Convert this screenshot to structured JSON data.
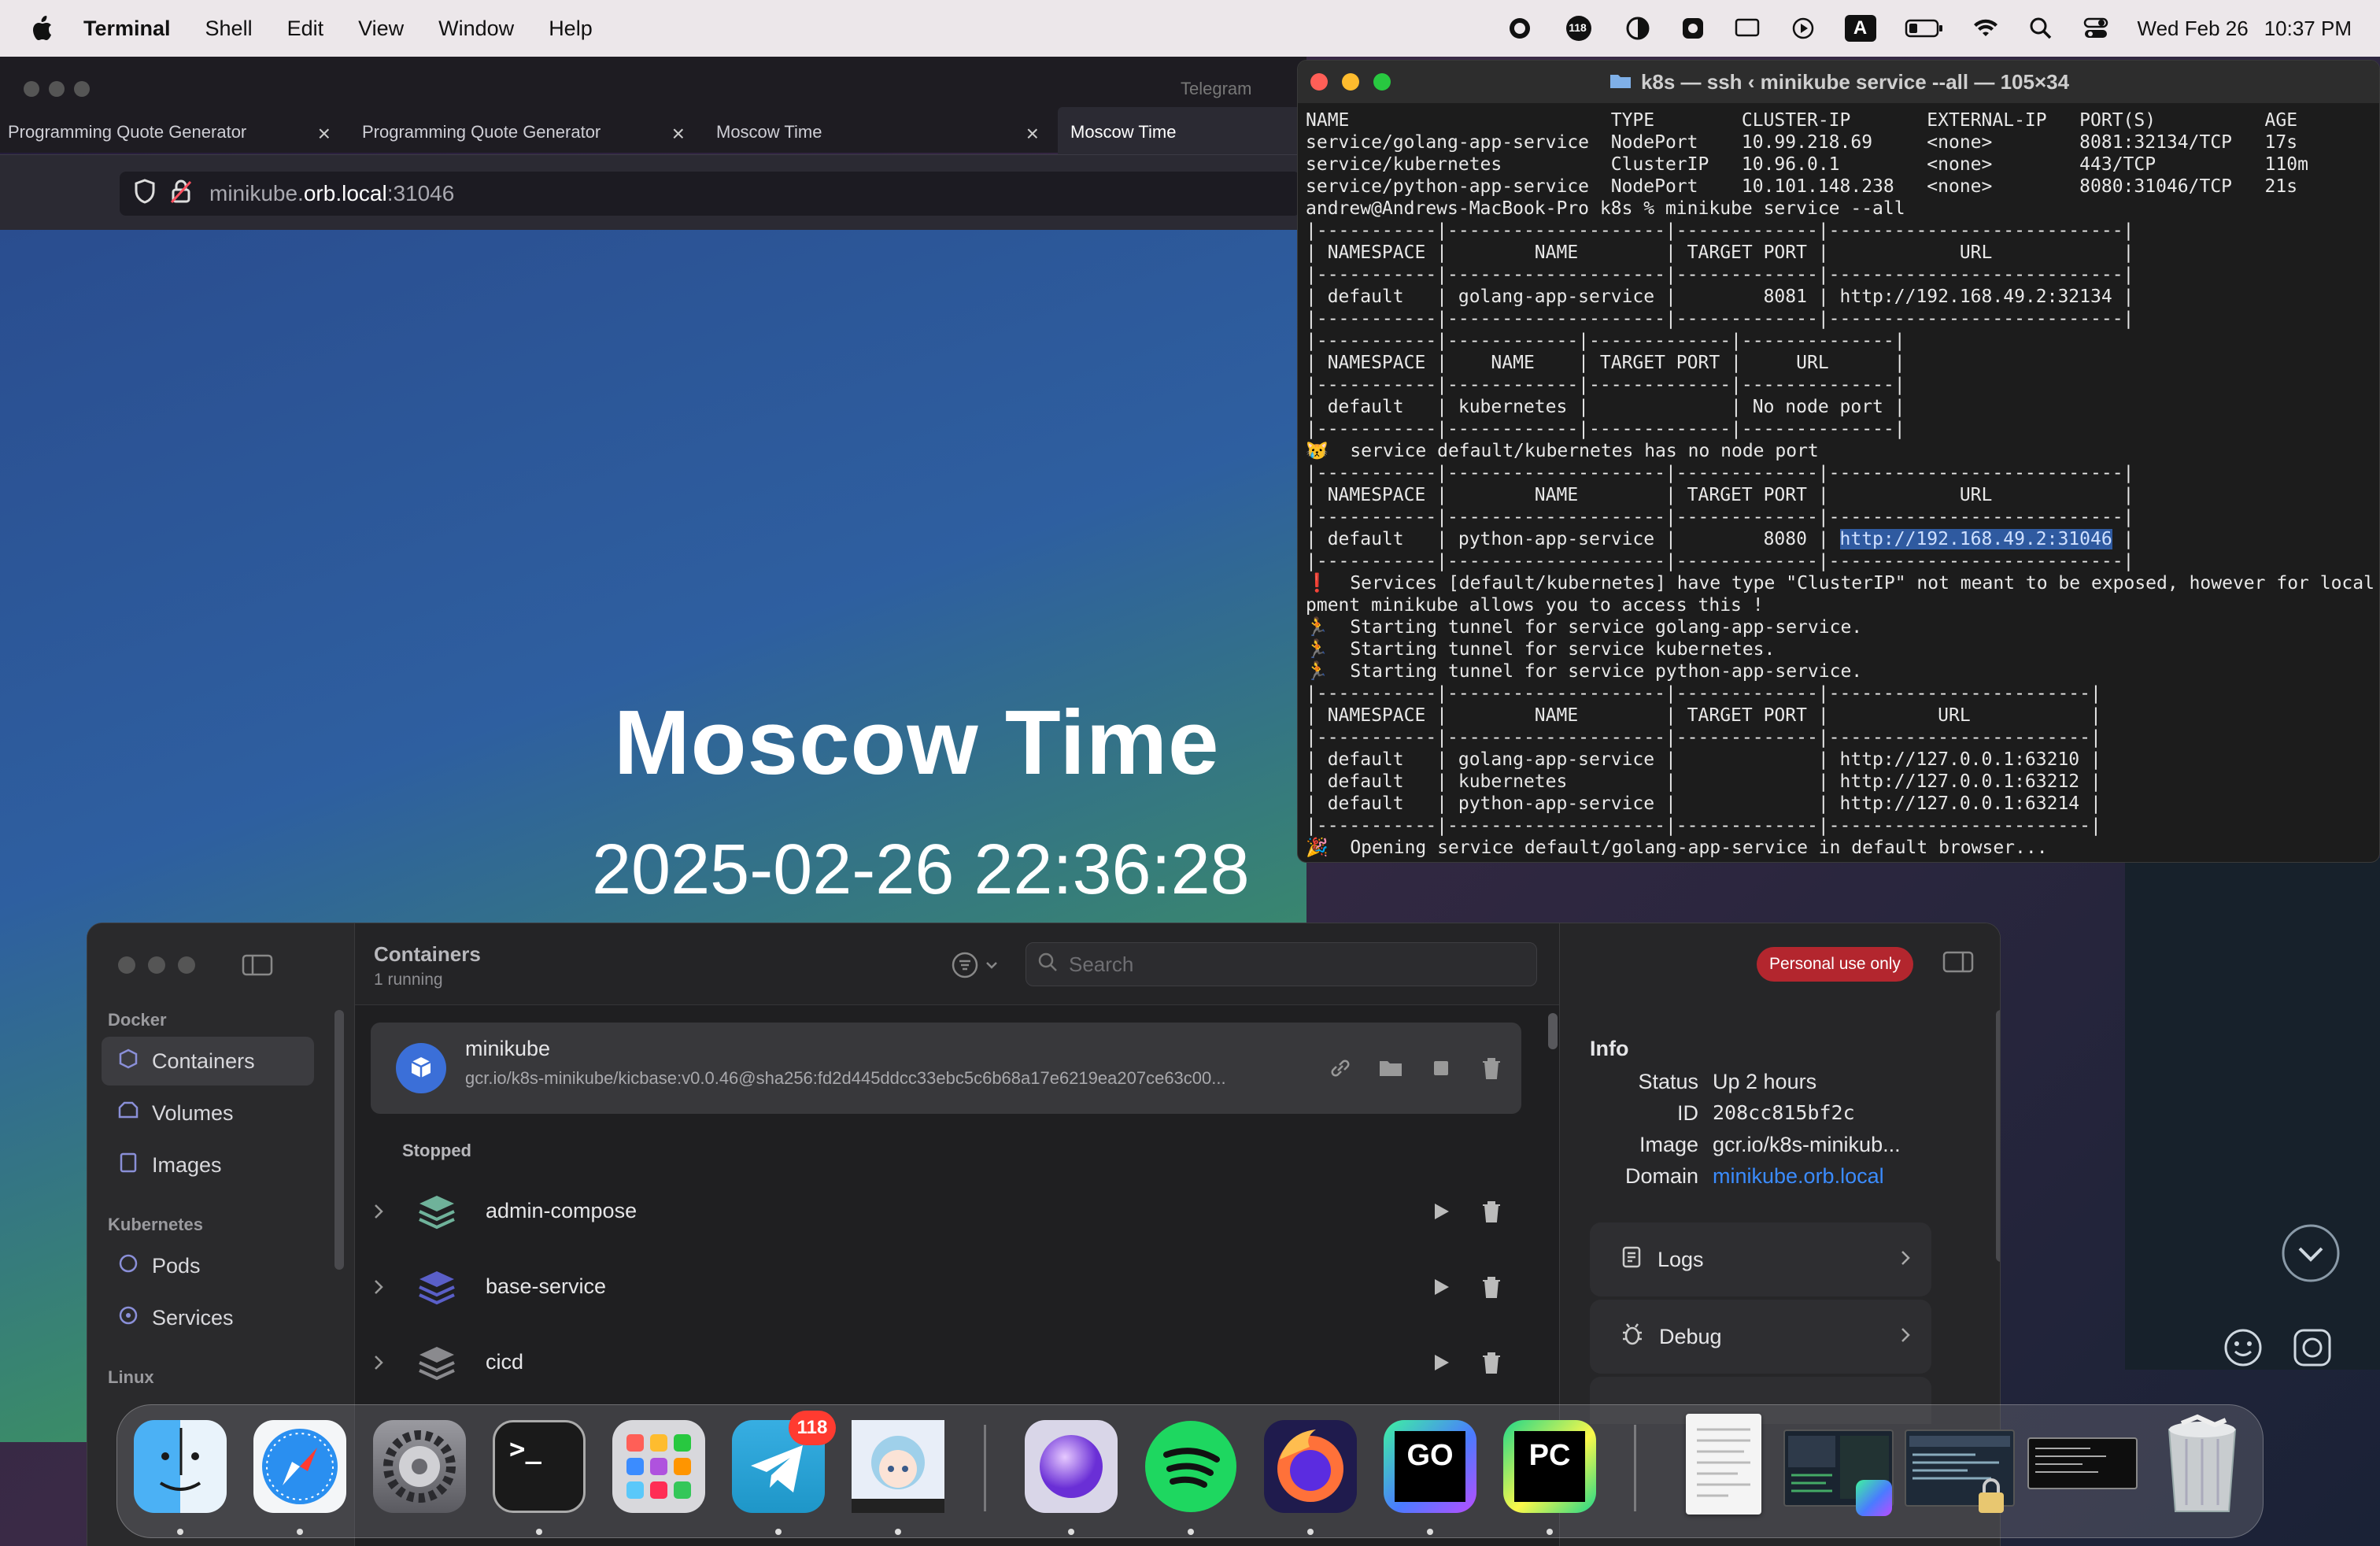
{
  "menubar": {
    "app": "Terminal",
    "menus": [
      "Shell",
      "Edit",
      "View",
      "Window",
      "Help"
    ],
    "notif_count": "118",
    "input_source": "A",
    "date": "Wed Feb 26",
    "time": "10:37 PM"
  },
  "telegram_title": "Telegram",
  "browser": {
    "tabs": [
      {
        "label": "Programming Quote Generator",
        "active": false
      },
      {
        "label": "Programming Quote Generator",
        "active": false
      },
      {
        "label": "Moscow Time",
        "active": false
      },
      {
        "label": "Moscow Time",
        "active": true
      }
    ],
    "url_prefix": "minikube.",
    "url_domain": "orb.local",
    "url_suffix": ":31046",
    "page_title": "Moscow Time",
    "page_time": "2025-02-26 22:36:28"
  },
  "terminal": {
    "title": "k8s — ssh ‹ minikube service --all — 105×34",
    "lines": [
      "NAME                        TYPE        CLUSTER-IP       EXTERNAL-IP   PORT(S)          AGE",
      "service/golang-app-service  NodePort    10.99.218.69     <none>        8081:32134/TCP   17s",
      "service/kubernetes          ClusterIP   10.96.0.1        <none>        443/TCP          110m",
      "service/python-app-service  NodePort    10.101.148.238   <none>        8080:31046/TCP   21s",
      "andrew@Andrews-MacBook-Pro k8s % minikube service --all",
      "|-----------|--------------------|-------------|---------------------------|",
      "| NAMESPACE |        NAME        | TARGET PORT |            URL            |",
      "|-----------|--------------------|-------------|---------------------------|",
      "| default   | golang-app-service |        8081 | http://192.168.49.2:32134 |",
      "|-----------|--------------------|-------------|---------------------------|",
      "|-----------|------------|-------------|--------------|",
      "| NAMESPACE |    NAME    | TARGET PORT |     URL      |",
      "|-----------|------------|-------------|--------------|",
      "| default   | kubernetes |             | No node port |",
      "|-----------|------------|-------------|--------------|",
      "😿  service default/kubernetes has no node port",
      "|-----------|--------------------|-------------|---------------------------|",
      "| NAMESPACE |        NAME        | TARGET PORT |            URL            |",
      "|-----------|--------------------|-------------|---------------------------|",
      "| default   | python-app-service |        8080 | http://192.168.49.2:31046 |",
      "|-----------|--------------------|-------------|---------------------------|",
      "❗  Services [default/kubernetes] have type \"ClusterIP\" not meant to be exposed, however for local",
      "pment minikube allows you to access this !",
      "🏃  Starting tunnel for service golang-app-service.",
      "🏃  Starting tunnel for service kubernetes.",
      "🏃  Starting tunnel for service python-app-service.",
      "|-----------|--------------------|-------------|------------------------|",
      "| NAMESPACE |        NAME        | TARGET PORT |          URL           |",
      "|-----------|--------------------|-------------|------------------------|",
      "| default   | golang-app-service |             | http://127.0.0.1:63210 |",
      "| default   | kubernetes         |             | http://127.0.0.1:63212 |",
      "| default   | python-app-service |             | http://127.0.0.1:63214 |",
      "|-----------|--------------------|-------------|------------------------|",
      "🎉  Opening service default/golang-app-service in default browser..."
    ],
    "highlight_line": 19,
    "highlight_text": "http://192.168.49.2:31046"
  },
  "orb": {
    "sidebar": {
      "docker_header": "Docker",
      "docker_items": [
        "Containers",
        "Volumes",
        "Images"
      ],
      "k8s_header": "Kubernetes",
      "k8s_items": [
        "Pods",
        "Services"
      ],
      "linux_header": "Linux"
    },
    "header": {
      "title": "Containers",
      "subtitle": "1 running",
      "search_placeholder": "Search",
      "badge": "Personal use only"
    },
    "running": {
      "name": "minikube",
      "image": "gcr.io/k8s-minikube/kicbase:v0.0.46@sha256:fd2d445ddcc33ebc5c6b68a17e6219ea207ce63c00..."
    },
    "stopped_header": "Stopped",
    "stopped": [
      "admin-compose",
      "base-service",
      "cicd"
    ],
    "info": {
      "header": "Info",
      "fields": [
        {
          "label": "Status",
          "value": "Up 2 hours"
        },
        {
          "label": "ID",
          "value": "208cc815bf2c"
        },
        {
          "label": "Image",
          "value": "gcr.io/k8s-minikub..."
        },
        {
          "label": "Domain",
          "value": "minikube.orb.local"
        }
      ],
      "actions": [
        "Logs",
        "Debug"
      ]
    }
  },
  "dock": {
    "telegram_badge": "118",
    "apps": [
      "Finder",
      "Safari",
      "System Settings",
      "Terminal",
      "Launchpad",
      "Telegram",
      "Anime Avatar",
      "Orb",
      "Spotify",
      "Firefox",
      "GoLand",
      "PyCharm",
      "Document",
      "Window 1",
      "Window 2",
      "Window 3",
      "Trash"
    ],
    "terminal_glyph": ">_",
    "goland_glyph": "GO",
    "pycharm_glyph": "PC"
  },
  "colors": {
    "link": "#3b8cff",
    "badge_red": "#b3262e",
    "traffic_red": "#ff5f57",
    "traffic_yellow": "#febc2e",
    "traffic_green": "#28c840"
  }
}
